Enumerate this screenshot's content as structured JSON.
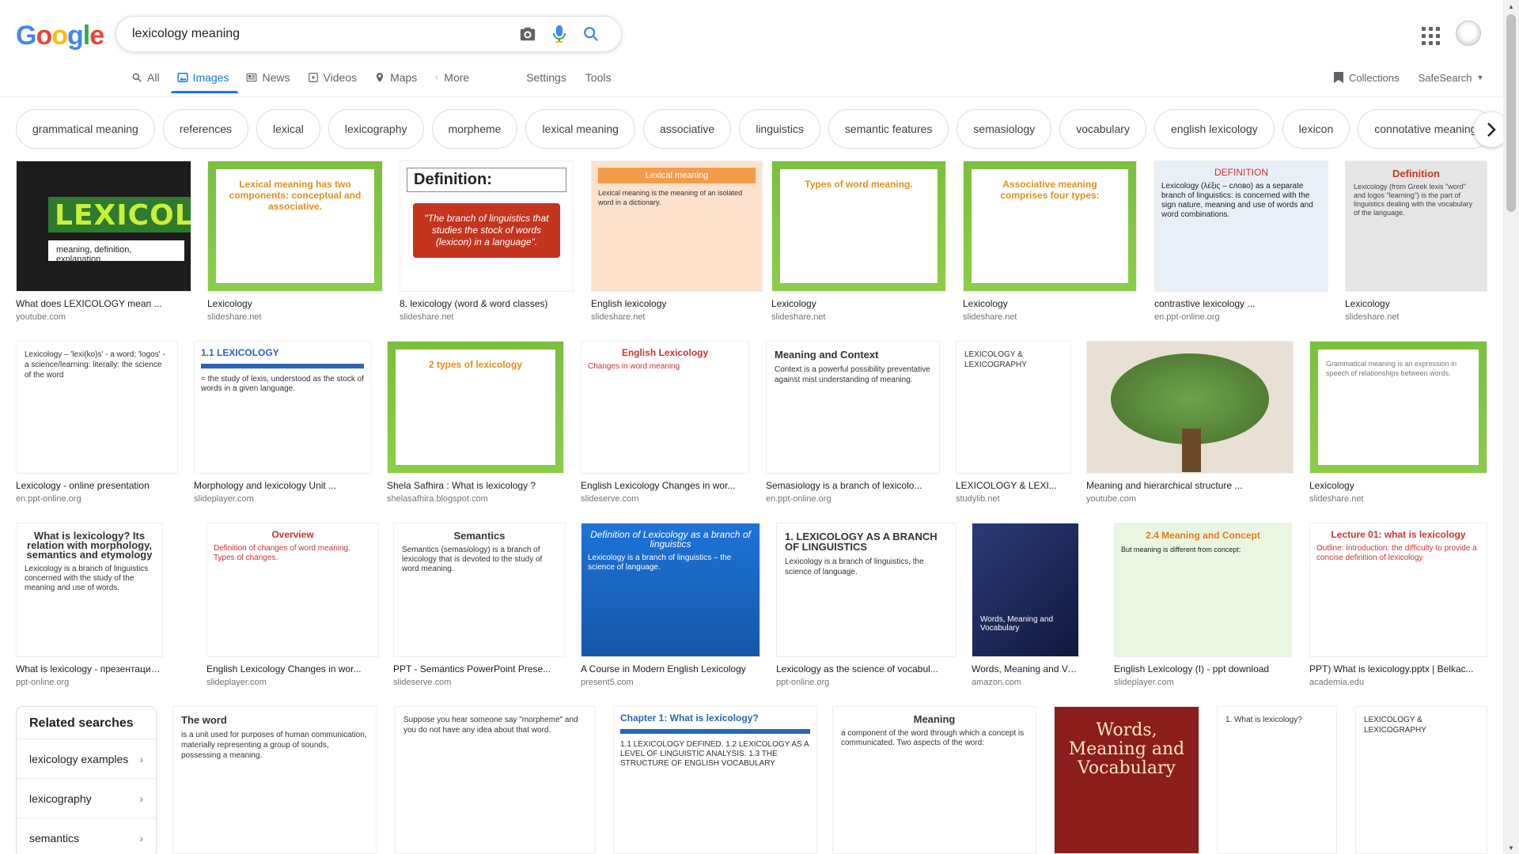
{
  "header": {
    "logo": "Google",
    "logo_letters": [
      {
        "ch": "G",
        "color": "#4285F4"
      },
      {
        "ch": "o",
        "color": "#EA4335"
      },
      {
        "ch": "o",
        "color": "#FBBC05"
      },
      {
        "ch": "g",
        "color": "#4285F4"
      },
      {
        "ch": "l",
        "color": "#34A853"
      },
      {
        "ch": "e",
        "color": "#EA4335"
      }
    ],
    "search_value": "lexicology meaning",
    "icons": [
      "camera-icon",
      "microphone-icon",
      "search-icon",
      "apps-grid-icon",
      "avatar"
    ]
  },
  "tabs": [
    {
      "label": "All",
      "icon": "search-icon"
    },
    {
      "label": "Images",
      "icon": "image-icon",
      "active": true
    },
    {
      "label": "News",
      "icon": "news-icon"
    },
    {
      "label": "Videos",
      "icon": "video-icon"
    },
    {
      "label": "Maps",
      "icon": "map-icon"
    },
    {
      "label": "More",
      "icon": "more-vert-icon"
    }
  ],
  "tools": {
    "settings": "Settings",
    "tools": "Tools"
  },
  "right_tabs": {
    "collections": "Collections",
    "safesearch": "SafeSearch"
  },
  "chips": [
    "grammatical meaning",
    "references",
    "lexical",
    "lexicography",
    "morpheme",
    "lexical meaning",
    "associative",
    "linguistics",
    "semantic features",
    "semasiology",
    "vocabulary",
    "english lexicology",
    "lexicon",
    "connotative meaning"
  ],
  "results": {
    "row1": [
      {
        "caption": "What does LEXICOLOGY mean ...",
        "source": "youtube.com",
        "thumb": {
          "word": "LEXICOLOGY",
          "sub": "meaning, definition, explanation..."
        }
      },
      {
        "caption": "Lexicology",
        "source": "slideshare.net",
        "thumb": {
          "title": "Lexical meaning has two components: conceptual and associative."
        }
      },
      {
        "caption": "8. lexicology (word & word classes)",
        "source": "slideshare.net",
        "thumb": {
          "head": "Definition:",
          "body": "\"The branch of linguistics that studies the stock of words (lexicon) in a language\"."
        }
      },
      {
        "caption": "English lexicology",
        "source": "slideshare.net",
        "thumb": {
          "head": "Lexical meaning",
          "body": "Lexical meaning is the meaning of an isolated word in a dictionary."
        }
      },
      {
        "caption": "Lexicology",
        "source": "slideshare.net",
        "thumb": {
          "title": "Types of word meaning."
        }
      },
      {
        "caption": "Lexicology",
        "source": "slideshare.net",
        "thumb": {
          "title": "Associative meaning comprises four types:"
        }
      },
      {
        "caption": "contrastive lexicology ...",
        "source": "en.ppt-online.org",
        "thumb": {
          "head": "DEFINITION",
          "body": "Lexicology (λέξις – слово) as a separate branch of linguistics: is concerned with the sign nature, meaning and use of words and word combinations."
        }
      },
      {
        "caption": "Lexicology",
        "source": "slideshare.net",
        "thumb": {
          "title": "Definition",
          "body": "Lexicology (from Greek lexis \"word\" and logos \"learning\") is the part of linguistics dealing with the vocabulary of the language."
        }
      }
    ],
    "row2": [
      {
        "caption": "Lexicology - online presentation",
        "source": "en.ppt-online.org",
        "thumb": {
          "body": "Lexicology – 'lexi(ko)s' - a word; 'logos' - a science/learning: literally: the science of the word"
        }
      },
      {
        "caption": "Morphology and lexicology Unit ...",
        "source": "slideplayer.com",
        "thumb": {
          "head": "1.1 LEXICOLOGY",
          "body": "= the study of lexis, understood as the stock of words in a given language."
        }
      },
      {
        "caption": "Shela Safhira : What is lexicology ?",
        "source": "shelasafhira.blogspot.com",
        "thumb": {
          "title": "2 types of lexicology"
        }
      },
      {
        "caption": "English Lexicology Changes in wor...",
        "source": "slideserve.com",
        "thumb": {
          "head": "English Lexicology",
          "body": "Changes in word meaning"
        }
      },
      {
        "caption": "Semasiology is a branch of lexicolo...",
        "source": "en.ppt-online.org",
        "thumb": {
          "head": "Meaning and Context",
          "body": "Context is a powerful possibility preventative against mist understanding of meaning."
        }
      },
      {
        "caption": "LEXICOLOGY & LEXI...",
        "source": "studylib.net",
        "thumb": {
          "body": "LEXICOLOGY & LEXICOGRAPHY"
        }
      },
      {
        "caption": "Meaning and hierarchical structure ...",
        "source": "youtube.com",
        "thumb": {}
      },
      {
        "caption": "Lexicology",
        "source": "slideshare.net",
        "thumb": {
          "body": "Grammatical meaning is an expression in speech of relationships between words."
        }
      }
    ],
    "row3": [
      {
        "caption": "What is lexicology - презентация о...",
        "source": "ppt-online.org",
        "thumb": {
          "head": "What is lexicology? Its relation with morphology, semantics and etymology",
          "body": "Lexicology is a branch of linguistics concerned with the study of the meaning and use of words."
        }
      },
      {
        "caption": "English Lexicology Changes in wor...",
        "source": "slideplayer.com",
        "thumb": {
          "head": "Overview",
          "body": "Definition of changes of word meaning. Types of changes."
        }
      },
      {
        "caption": "PPT - Semantics PowerPoint Prese...",
        "source": "slideserve.com",
        "thumb": {
          "head": "Semantics",
          "body": "Semantics (semasiology) is a branch of lexicology that is devoted to the study of word meaning."
        }
      },
      {
        "caption": "A Course in Modern English Lexicology",
        "source": "present5.com",
        "thumb": {
          "head": "Definition of Lexicology as a branch of linguistics",
          "body": "Lexicology is a branch of linguistics – the science of language."
        }
      },
      {
        "caption": "Lexicology as the science of vocabul...",
        "source": "ppt-online.org",
        "thumb": {
          "head": "1. LEXICOLOGY AS A BRANCH OF LINGUISTICS",
          "body": "Lexicology is a branch of linguistics, the science of language."
        }
      },
      {
        "caption": "Words, Meaning and Vo...",
        "source": "amazon.com",
        "thumb": {
          "body": "Words, Meaning and Vocabulary"
        }
      },
      {
        "caption": "English Lexicology (I) - ppt download",
        "source": "slideplayer.com",
        "thumb": {
          "head": "2.4 Meaning and Concept",
          "body": "But meaning is different from concept:"
        }
      },
      {
        "caption": "PPT) What is lexicology.pptx | Belkac...",
        "source": "academia.edu",
        "thumb": {
          "head": "Lecture 01: what is lexicology",
          "body": "Outline: Introduction: the difficulty to provide a concise definition of lexicology"
        }
      }
    ],
    "row4": [
      {
        "thumb": {
          "head": "The word",
          "body": "is a unit used for purposes of human communication, materially representing a group of sounds, possessing a meaning."
        }
      },
      {
        "thumb": {
          "body": "Suppose you hear someone say \"morpheme\" and you do not have any idea about that word."
        }
      },
      {
        "thumb": {
          "head": "Chapter 1: What is lexicology?",
          "body": "1.1 LEXICOLOGY DEFINED. 1.2 LEXICOLOGY AS A LEVEL OF LINGUISTIC ANALYSIS. 1.3 THE STRUCTURE OF ENGLISH VOCABULARY"
        }
      },
      {
        "thumb": {
          "head": "Meaning",
          "body": "a component of the word through which a concept is communicated. Two aspects of the word:"
        }
      },
      {
        "thumb": {
          "head": "Words, Meaning and Vocabulary"
        }
      },
      {
        "thumb": {
          "body": "1. What is lexicology?"
        }
      },
      {
        "thumb": {
          "body": "LEXICOLOGY & LEXICOGRAPHY"
        }
      }
    ]
  },
  "related": {
    "title": "Related searches",
    "items": [
      "lexicology examples",
      "lexicography",
      "semantics"
    ]
  }
}
